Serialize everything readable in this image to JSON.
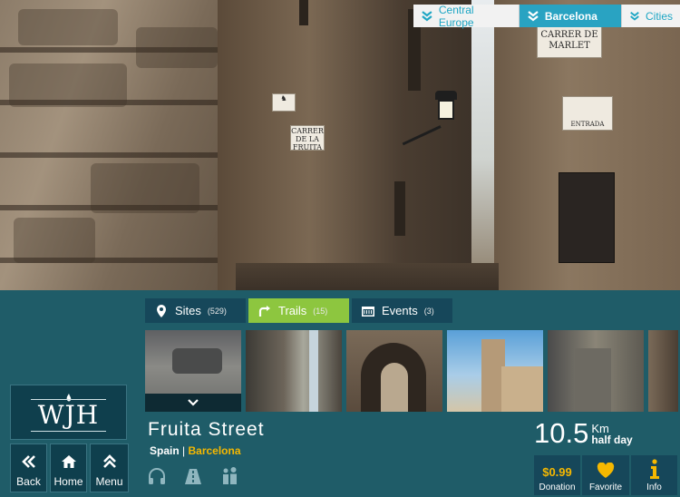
{
  "breadcrumbs": [
    {
      "label": "Central Europe",
      "active": false
    },
    {
      "label": "Barcelona",
      "active": true
    },
    {
      "label": "Cities",
      "active": false
    }
  ],
  "hero_signs": {
    "left_sign": "CARRER\nDE LA\nFRUITA",
    "right_sign_top": "CARRER DE\nMARLET",
    "right_sign_entrada": "ENTRADA"
  },
  "tabs": [
    {
      "label": "Sites",
      "count": "(529)",
      "icon": "map-pin-icon",
      "active": false
    },
    {
      "label": "Trails",
      "count": "(15)",
      "icon": "trail-arrow-icon",
      "active": true
    },
    {
      "label": "Events",
      "count": "(3)",
      "icon": "calendar-icon",
      "active": false
    }
  ],
  "logo": {
    "text": "WJH"
  },
  "nav": [
    {
      "label": "Back",
      "icon": "double-chevron-left-icon"
    },
    {
      "label": "Home",
      "icon": "home-icon"
    },
    {
      "label": "Menu",
      "icon": "double-chevron-up-icon"
    }
  ],
  "trail": {
    "title": "Fruita Street",
    "country": "Spain",
    "separator": "|",
    "city": "Barcelona",
    "distance": "10.5",
    "unit": "Km",
    "duration": "half day"
  },
  "feature_icons": [
    "headphones-icon",
    "road-icon",
    "people-icon"
  ],
  "actions": [
    {
      "label": "Donation",
      "value": "$0.99",
      "icon": ""
    },
    {
      "label": "Favorite",
      "value": "",
      "icon": "heart-icon"
    },
    {
      "label": "Info",
      "value": "",
      "icon": "info-icon"
    }
  ],
  "colors": {
    "accent_blue": "#29a3c2",
    "trail_green": "#8dc63f",
    "panel_teal": "#1f5c68",
    "gold": "#f5b800"
  }
}
